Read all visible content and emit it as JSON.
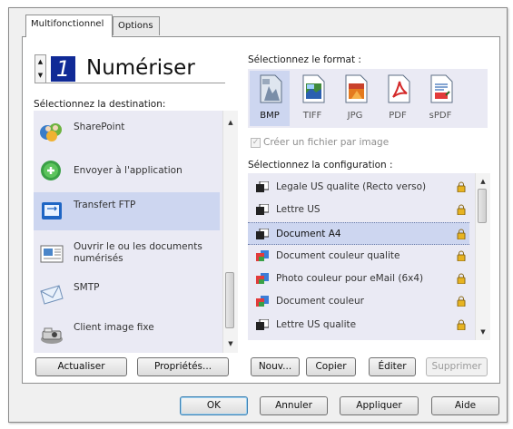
{
  "tabs": [
    "Multifonctionnel",
    "Options"
  ],
  "scan_button": {
    "number": "1",
    "label": "Numériser"
  },
  "destination": {
    "label": "Sélectionnez la destination:",
    "items": [
      {
        "name": "SharePoint",
        "icon": "sharepoint-icon"
      },
      {
        "name": "Envoyer à l'application",
        "icon": "send-to-application-icon"
      },
      {
        "name": "Transfert FTP",
        "icon": "ftp-transfer-icon"
      },
      {
        "name": "Ouvrir le ou les documents numérisés",
        "icon": "open-scanned-documents-icon"
      },
      {
        "name": "SMTP",
        "icon": "smtp-mail-icon"
      },
      {
        "name": "Client image fixe",
        "icon": "still-image-client-icon"
      }
    ],
    "selected": "Transfert FTP"
  },
  "format": {
    "label": "Sélectionnez le format :",
    "options": [
      {
        "name": "BMP",
        "icon": "bmp-format-icon"
      },
      {
        "name": "TIFF",
        "icon": "tiff-format-icon"
      },
      {
        "name": "JPG",
        "icon": "jpg-format-icon"
      },
      {
        "name": "PDF",
        "icon": "pdf-format-icon"
      },
      {
        "name": "sPDF",
        "icon": "spdf-format-icon"
      }
    ],
    "selected": "BMP",
    "checkbox_label": "Créer un fichier par image",
    "checkbox_checked": true,
    "checkbox_enabled": false
  },
  "configuration": {
    "label": "Sélectionnez la configuration :",
    "items": [
      {
        "name": "Legale US qualite (Recto verso)",
        "icon": "black-white-document-icon"
      },
      {
        "name": "Lettre US",
        "icon": "black-white-document-icon"
      },
      {
        "name": "Document A4",
        "icon": "black-white-document-icon"
      },
      {
        "name": "Document couleur qualite",
        "icon": "color-document-icon"
      },
      {
        "name": "Photo couleur pour eMail (6x4)",
        "icon": "color-document-icon"
      },
      {
        "name": "Document couleur",
        "icon": "color-document-icon"
      },
      {
        "name": "Lettre US qualite",
        "icon": "black-white-document-icon"
      }
    ],
    "selected": "Document A4"
  },
  "left_buttons": {
    "refresh": "Actualiser",
    "properties": "Propriétés..."
  },
  "config_buttons": {
    "new": "Nouv...",
    "copy": "Copier",
    "edit": "Éditer",
    "delete": "Supprimer"
  },
  "dialog_buttons": {
    "ok": "OK",
    "cancel": "Annuler",
    "apply": "Appliquer",
    "help": "Aide"
  },
  "colors": {
    "selection": "#cdd6f0",
    "list_background": "#eaeaf4",
    "accent_blue": "#1f4fb8"
  }
}
